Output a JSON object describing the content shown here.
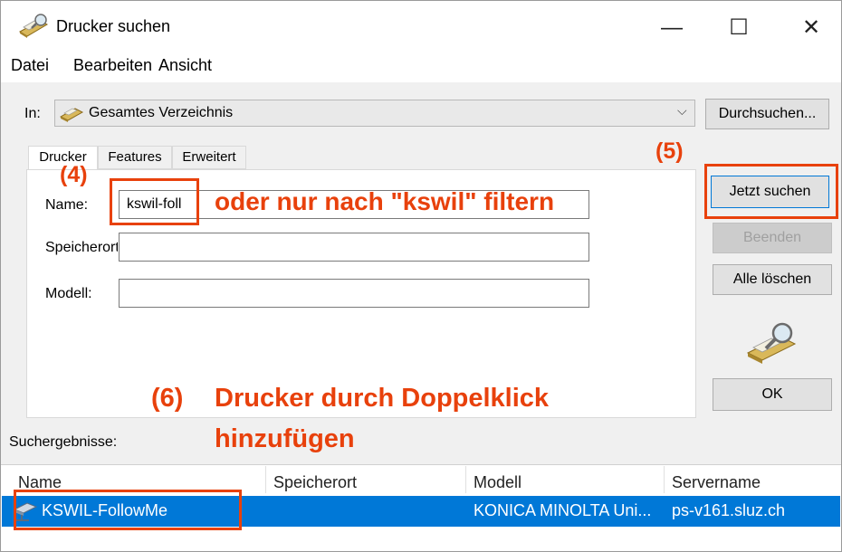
{
  "window": {
    "title": "Drucker suchen",
    "icon": "printer-search-icon",
    "controls": {
      "minimize": "—",
      "maximize": "☐",
      "close": "✕"
    }
  },
  "menu": [
    "Datei",
    "Bearbeiten",
    "Ansicht"
  ],
  "search_in": {
    "label": "In:",
    "value": "Gesamtes Verzeichnis",
    "browse_button": "Durchsuchen..."
  },
  "tabs": [
    "Drucker",
    "Features",
    "Erweitert"
  ],
  "form": {
    "name_label": "Name:",
    "name_value": "kswil-foll",
    "location_label": "Speicherort:",
    "location_value": "",
    "model_label": "Modell:",
    "model_value": ""
  },
  "buttons": {
    "search_now": "Jetzt suchen",
    "stop": "Beenden",
    "clear_all": "Alle löschen",
    "ok": "OK"
  },
  "results": {
    "label": "Suchergebnisse:",
    "columns": [
      "Name",
      "Speicherort",
      "Modell",
      "Servername"
    ],
    "rows": [
      {
        "name": "KSWIL-FollowMe",
        "location": "",
        "model": "KONICA MINOLTA Uni...",
        "server": "ps-v161.sluz.ch",
        "selected": true
      }
    ]
  },
  "annotations": {
    "step4": "(4)",
    "step5": "(5)",
    "step6": "(6)",
    "filter_hint": "oder nur nach \"kswil\" filtern",
    "doubleclick_hint_line1": "Drucker durch Doppelklick",
    "doubleclick_hint_line2": "hinzufügen",
    "color": "#e8410c"
  },
  "colors": {
    "selection": "#0078d7",
    "window_bg": "#f0f0f0"
  }
}
